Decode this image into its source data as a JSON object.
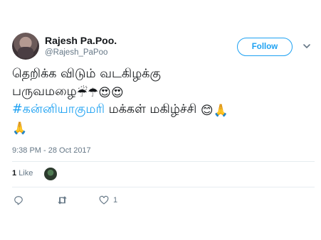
{
  "user": {
    "display_name": "Rajesh Pa.Poo.",
    "handle": "@Rajesh_PaPoo"
  },
  "follow_button": {
    "label": "Follow"
  },
  "tweet": {
    "line1": "தெறிக்க விடும் வடகிழக்கு",
    "line2_text": "பருவமழை",
    "hashtag": "#கன்னியாகுமரி",
    "line3_text": " மக்கள் மகிழ்ச்சி ",
    "emojis": {
      "rain": "☔",
      "umbrella": "☂",
      "heart_eyes": "😍",
      "smile": "😊",
      "pray": "🙏"
    }
  },
  "timestamp": "9:38 PM - 28 Oct 2017",
  "stats": {
    "likes_count": "1",
    "likes_label": "Like"
  },
  "actions": {
    "like_count": "1"
  },
  "colors": {
    "accent": "#1da1f2",
    "secondary_text": "#657786",
    "primary_text": "#14171a",
    "divider": "#e6ecf0"
  },
  "icons": [
    "chevron-down-icon",
    "reply-icon",
    "retweet-icon",
    "heart-icon"
  ]
}
